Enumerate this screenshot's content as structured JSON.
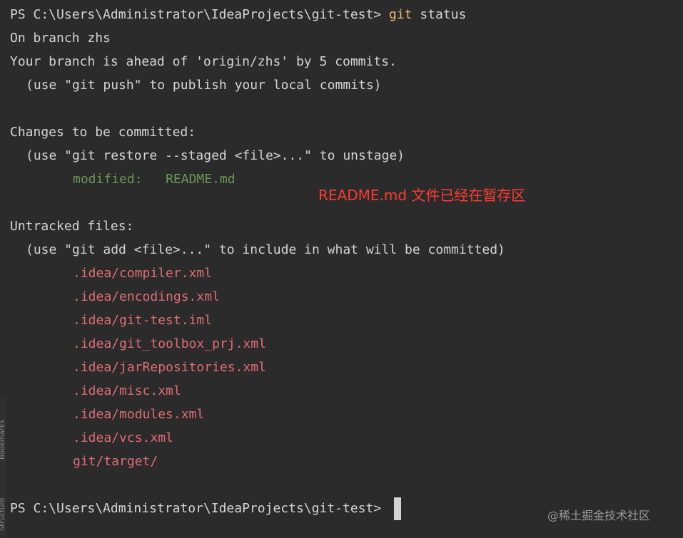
{
  "prompt_path": "PS C:\\Users\\Administrator\\IdeaProjects\\git-test> ",
  "command": "git",
  "command_args": " status",
  "output": {
    "branch_line": "On branch zhs",
    "ahead_line": "Your branch is ahead of 'origin/zhs' by 5 commits.",
    "push_hint": "(use \"git push\" to publish your local commits)",
    "staged_heading": "Changes to be committed:",
    "staged_hint": "(use \"git restore --staged <file>...\" to unstage)",
    "staged_files": [
      {
        "status": "modified:",
        "file": "README.md"
      }
    ],
    "untracked_heading": "Untracked files:",
    "untracked_hint": "(use \"git add <file>...\" to include in what will be committed)",
    "untracked_files": [
      ".idea/compiler.xml",
      ".idea/encodings.xml",
      ".idea/git-test.iml",
      ".idea/git_toolbox_prj.xml",
      ".idea/jarRepositories.xml",
      ".idea/misc.xml",
      ".idea/modules.xml",
      ".idea/vcs.xml",
      "git/target/"
    ]
  },
  "final_prompt": "PS C:\\Users\\Administrator\\IdeaProjects\\git-test> ",
  "annotation": "README.md 文件已经在暂存区",
  "side_tabs": {
    "bookmarks": "Bookmarks",
    "structure": "Structure"
  },
  "watermark": "@稀土掘金技术社区",
  "colors": {
    "background": "#2b2b2b",
    "text": "#d4d4d4",
    "command": "#e8bf6a",
    "modified": "#6a9955",
    "untracked": "#e06c75",
    "annotation": "#ff3b30"
  }
}
